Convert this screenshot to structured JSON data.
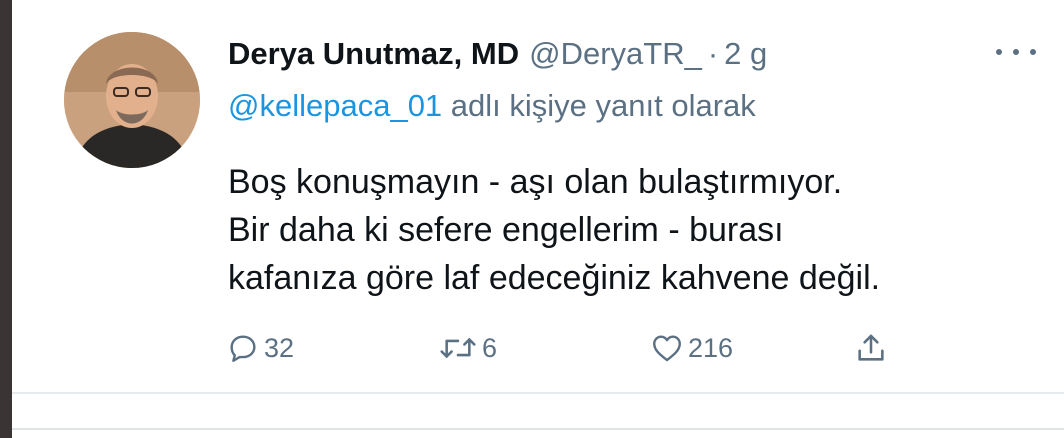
{
  "tweet": {
    "author_name": "Derya Unutmaz, MD",
    "author_handle": "@DeryaTR_",
    "separator": "·",
    "time": "2 g",
    "reply_mention": "@kellepaca_01",
    "reply_suffix": " adlı kişiye yanıt olarak",
    "text_lines": [
      "Boş konuşmayın - aşı olan bulaştırmıyor.",
      "Bir daha ki sefere engellerim - burası",
      "kafanıza göre laf edeceğiniz kahvene değil."
    ],
    "actions": {
      "reply_count": "32",
      "retweet_count": "6",
      "like_count": "216"
    },
    "icons": {
      "reply": "speech-bubble-icon",
      "retweet": "retweet-arrows-icon",
      "like": "heart-icon",
      "share": "share-upload-icon",
      "more": "more-dots-icon"
    }
  },
  "colors": {
    "text": "#0f1419",
    "secondary": "#5b7083",
    "link": "#1b95e0"
  }
}
